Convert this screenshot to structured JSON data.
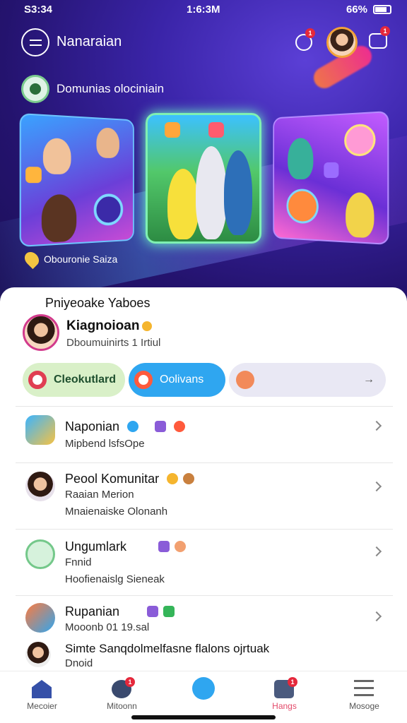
{
  "status_bar": {
    "time": "S3:34",
    "clock": "1:6:3M",
    "battery_percent": "66%"
  },
  "header": {
    "title": "Nanaraian",
    "search_badge": "1",
    "chat_badge": "1"
  },
  "hero": {
    "community_label": "Domunias olociniain",
    "subtitle": "Obouronie Saiza"
  },
  "sheet": {
    "title": "Pniyeoake Yaboes",
    "profile": {
      "name": "Kiagnoioan",
      "subtitle": "Dboumuinirts 1 Irtiul"
    },
    "pills": [
      {
        "label": "Cleokutlard"
      },
      {
        "label": "Oolivans"
      },
      {
        "label": ""
      }
    ]
  },
  "list": [
    {
      "title": "Naponian",
      "lines": [
        "Mipbend lsfsOpe"
      ]
    },
    {
      "title": "Peool Komunitar",
      "lines": [
        "Raaian Merion",
        "Mnaienaiske Olonanh"
      ]
    },
    {
      "title": "Ungumlark",
      "lines": [
        "Fnnid",
        "Hoofienaislg Sieneak"
      ]
    },
    {
      "title": "Rupanian",
      "lines": [
        "Mooonb 01 19.sal"
      ]
    },
    {
      "title": "Simte Sanqdolmelfasne flalons ojrtuak",
      "lines": [
        "Dnoid"
      ]
    }
  ],
  "tabbar": {
    "tabs": [
      {
        "label": "Mecoier",
        "badge": ""
      },
      {
        "label": "Mitoonn",
        "badge": "1"
      },
      {
        "label": "",
        "badge": ""
      },
      {
        "label": "Hangs",
        "badge": "1"
      },
      {
        "label": "Mosoge",
        "badge": ""
      }
    ]
  },
  "colors": {
    "hero_bg": "#2a1a6e",
    "accent_blue": "#2fa6f0",
    "accent_green_pill": "#d9f0c8",
    "badge_red": "#e5283b",
    "active_tab": "#e34a6a"
  }
}
